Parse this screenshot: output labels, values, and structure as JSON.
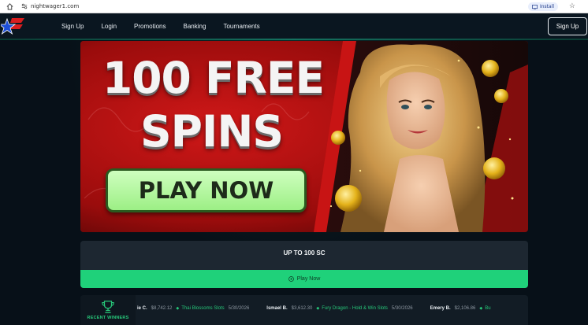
{
  "browser": {
    "url": "nightwager1.com",
    "install_label": "Install"
  },
  "nav": {
    "links": [
      "Sign Up",
      "Login",
      "Promotions",
      "Banking",
      "Tournaments"
    ],
    "signup_button": "Sign Up"
  },
  "hero": {
    "line1": "100 FREE",
    "line2": "SPINS",
    "cta": "PLAY NOW"
  },
  "offer": {
    "title": "UP TO 100 SC",
    "button": "Play Now"
  },
  "winners": {
    "label": "RECENT WINNERS",
    "items": [
      {
        "name": "ie C.",
        "amount": "$8,742.12",
        "game": "Thai Blossoms Slots",
        "date": "5/30/2026"
      },
      {
        "name": "Ismael B.",
        "amount": "$3,612.30",
        "game": "Fury Dragon - Hold & Win Slots",
        "date": "5/30/2026"
      },
      {
        "name": "Emery B.",
        "amount": "$2,106.86",
        "game": "Bu",
        "date": ""
      }
    ]
  },
  "colors": {
    "accent_green": "#1fd17a",
    "hero_red": "#b40f0f",
    "nav_bg": "#0a1620"
  }
}
